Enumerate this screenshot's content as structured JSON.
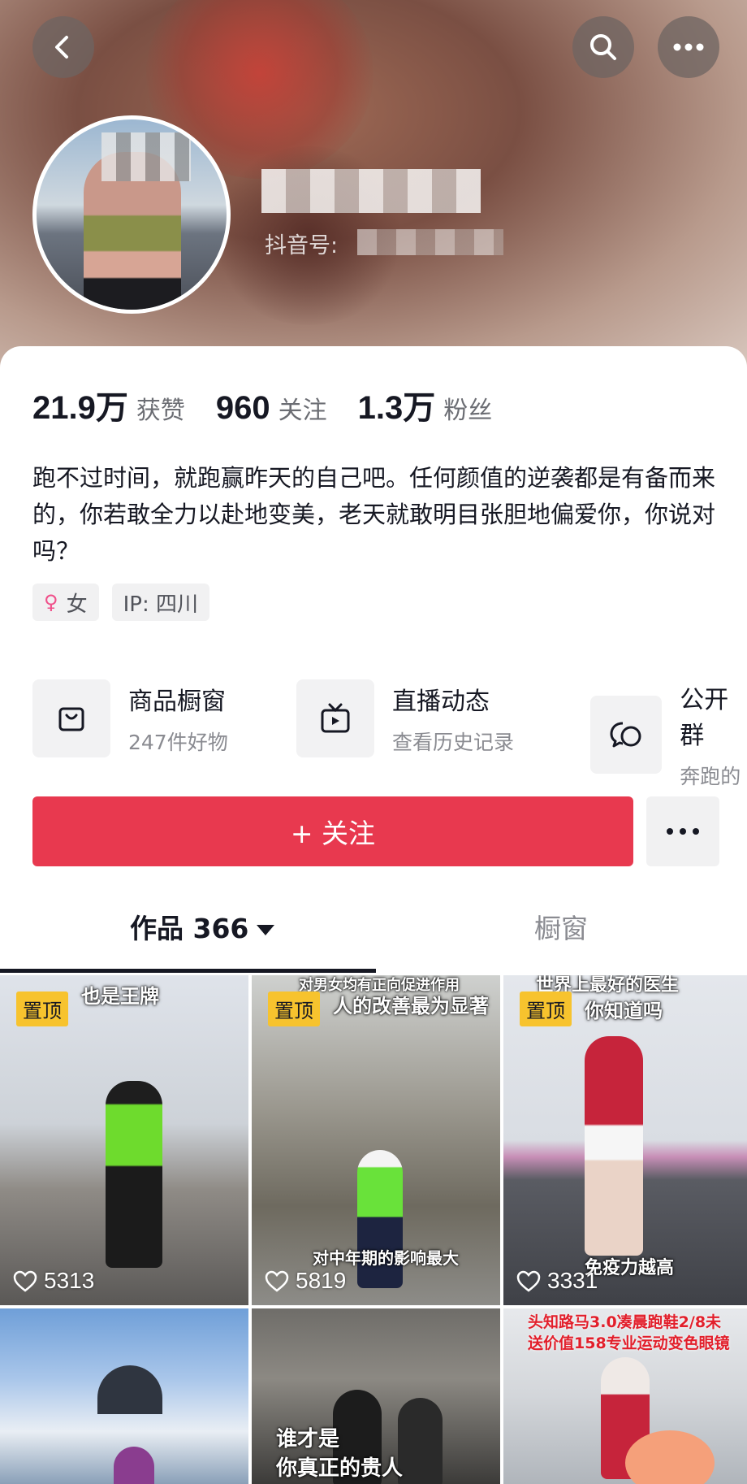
{
  "header": {
    "douyin_id_label": "抖音号:",
    "icons": [
      "back-icon",
      "search-icon",
      "more-icon"
    ]
  },
  "stats": [
    {
      "value": "21.9万",
      "label": "获赞"
    },
    {
      "value": "960",
      "label": "关注"
    },
    {
      "value": "1.3万",
      "label": "粉丝"
    }
  ],
  "bio": "跑不过时间，就跑赢昨天的自己吧。任何颜值的逆袭都是有备而来的，你若敢全力以赴地变美，老天就敢明目张胆地偏爱你，你说对吗？",
  "tags": {
    "gender": "女",
    "ip": "IP:  四川"
  },
  "features": [
    {
      "title": "商品橱窗",
      "subtitle": "247件好物",
      "icon": "bag-icon"
    },
    {
      "title": "直播动态",
      "subtitle": "查看历史记录",
      "icon": "tv-icon"
    },
    {
      "title": "公开群",
      "subtitle": "奔跑的",
      "icon": "chat-icon"
    }
  ],
  "follow_button": "+ 关注",
  "tabs": {
    "works": "作品 366",
    "window": "橱窗"
  },
  "videos": [
    {
      "pinned": "置顶",
      "caption": "也是王牌",
      "likes": "5313"
    },
    {
      "pinned": "置顶",
      "caption_top": "对男女均有正向促进作用",
      "caption": "人的改善最为显著",
      "caption2": "对中年期的影响最大",
      "likes": "5819"
    },
    {
      "pinned": "置顶",
      "caption_top": "世界上最好的医生",
      "caption": "你知道吗",
      "caption2": "免疫力越高",
      "likes": "3331"
    },
    {
      "caption": ""
    },
    {
      "caption": "谁才是",
      "caption2": "你真正的贵人"
    },
    {
      "caption": "头知路马3.0凑晨跑鞋2/8未",
      "caption2": "送价值158专业运动变色眼镜"
    }
  ],
  "colors": {
    "follow": "#e8394f",
    "pin": "#f7c32e",
    "female": "#f0508a"
  }
}
